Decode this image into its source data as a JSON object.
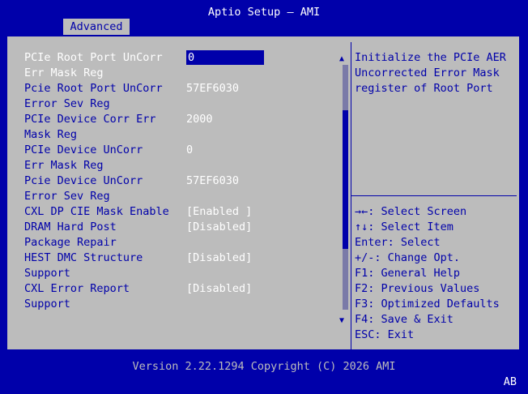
{
  "header": {
    "title": "Aptio Setup – AMI",
    "tab": "Advanced"
  },
  "settings": [
    {
      "label_lines": [
        "PCIe Root Port UnCorr",
        "Err Mask Reg"
      ],
      "value": "0",
      "selected": true
    },
    {
      "label_lines": [
        "Pcie Root Port UnCorr",
        "Error Sev Reg"
      ],
      "value": "57EF6030"
    },
    {
      "label_lines": [
        "PCIe Device Corr Err",
        "Mask Reg"
      ],
      "value": "2000"
    },
    {
      "label_lines": [
        "PCIe Device UnCorr",
        "Err Mask Reg"
      ],
      "value": "0"
    },
    {
      "label_lines": [
        "Pcie Device UnCorr",
        "Error Sev Reg"
      ],
      "value": "57EF6030"
    },
    {
      "label_lines": [
        "CXL DP CIE Mask Enable"
      ],
      "value": "[Enabled ]"
    },
    {
      "label_lines": [
        "DRAM Hard Post",
        "Package Repair"
      ],
      "value": "[Disabled]"
    },
    {
      "label_lines": [
        "HEST DMC Structure",
        "Support"
      ],
      "value": "[Disabled]"
    },
    {
      "label_lines": [
        "CXL Error Report",
        "Support"
      ],
      "value": "[Disabled]"
    }
  ],
  "help": {
    "lines": [
      "Initialize the PCIe AER",
      "Uncorrected Error Mask",
      "register of Root Port"
    ]
  },
  "keys": [
    "→←: Select Screen",
    "↑↓: Select Item",
    "Enter: Select",
    "+/-: Change Opt.",
    "F1: General Help",
    "F2: Previous Values",
    "F3: Optimized Defaults",
    "F4: Save & Exit",
    "ESC: Exit"
  ],
  "scrollbar": {
    "up_icon": "▲",
    "down_icon": "▼",
    "position_fraction": 0.43
  },
  "footer": {
    "version": "Version 2.22.1294 Copyright (C) 2026 AMI",
    "badge": "AB"
  }
}
